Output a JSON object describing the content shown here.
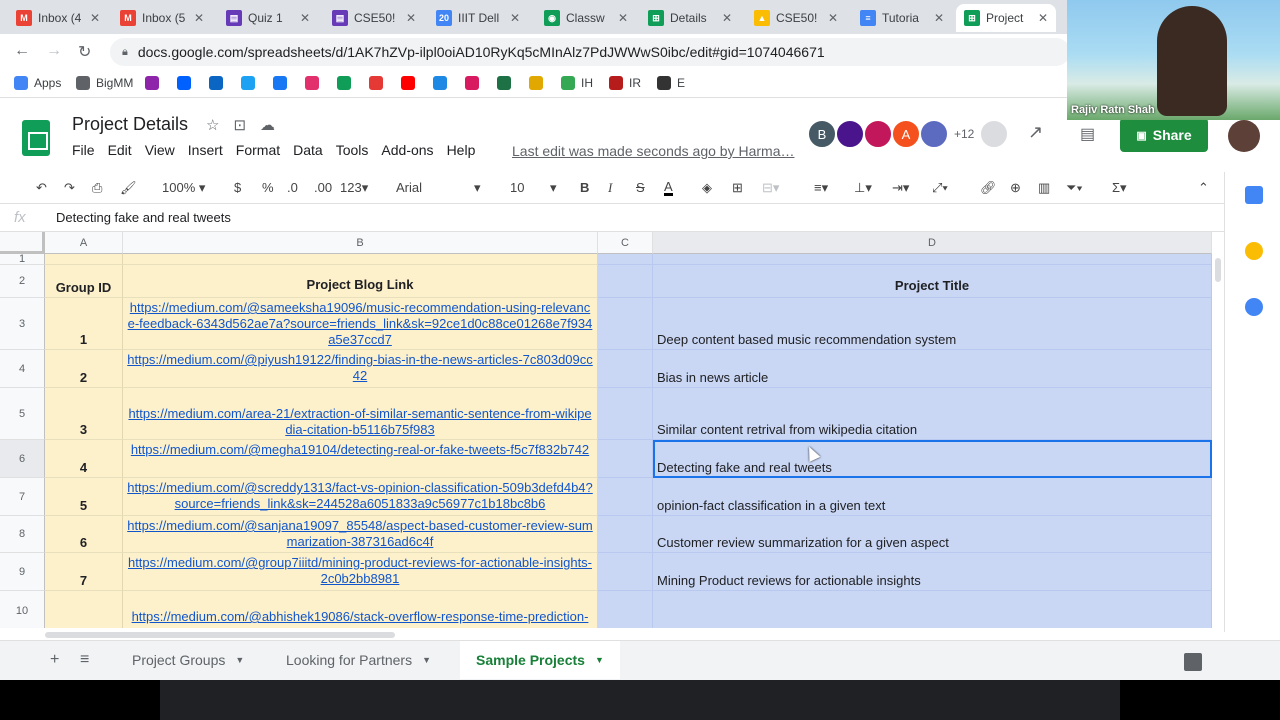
{
  "browser": {
    "tabs": [
      {
        "label": "Inbox (4",
        "fav": "M",
        "color": "#ea4335"
      },
      {
        "label": "Inbox (5",
        "fav": "M",
        "color": "#ea4335"
      },
      {
        "label": "Quiz 1",
        "fav": "▤",
        "color": "#673ab7"
      },
      {
        "label": "CSE50!",
        "fav": "▤",
        "color": "#673ab7"
      },
      {
        "label": "IIIT Dell",
        "fav": "20",
        "color": "#4285f4"
      },
      {
        "label": "Classw",
        "fav": "◉",
        "color": "#0f9d58"
      },
      {
        "label": "Details",
        "fav": "⊞",
        "color": "#0f9d58"
      },
      {
        "label": "CSE50!",
        "fav": "▲",
        "color": "#fbbc04"
      },
      {
        "label": "Tutoria",
        "fav": "≡",
        "color": "#4285f4"
      },
      {
        "label": "Project",
        "fav": "⊞",
        "color": "#0f9d58"
      }
    ],
    "url": "docs.google.com/spreadsheets/d/1AK7hZVp-ilpl0oiAD10RyKq5cMInAlz7PdJWWwS0ibc/edit#gid=1074046671",
    "bookmarks": [
      {
        "label": "Apps",
        "color": "#4285f4"
      },
      {
        "label": "BigMM",
        "color": "#5f6368"
      },
      {
        "label": "",
        "color": "#8e24aa"
      },
      {
        "label": "",
        "color": "#0061ff"
      },
      {
        "label": "",
        "color": "#0a66c2"
      },
      {
        "label": "",
        "color": "#1da1f2"
      },
      {
        "label": "",
        "color": "#1877f2"
      },
      {
        "label": "",
        "color": "#e1306c"
      },
      {
        "label": "",
        "color": "#0f9d58"
      },
      {
        "label": "",
        "color": "#e53935"
      },
      {
        "label": "",
        "color": "#ff0000"
      },
      {
        "label": "",
        "color": "#1e88e5"
      },
      {
        "label": "",
        "color": "#d81b60"
      },
      {
        "label": "",
        "color": "#1e7145"
      },
      {
        "label": "",
        "color": "#e0a800"
      },
      {
        "label": "IH",
        "color": "#34a853"
      },
      {
        "label": "IR",
        "color": "#b71c1c"
      },
      {
        "label": "E",
        "color": "#333333"
      }
    ]
  },
  "video": {
    "name": "Rajiv Ratn Shah"
  },
  "doc": {
    "title": "Project Details",
    "menu": [
      "File",
      "Edit",
      "View",
      "Insert",
      "Format",
      "Data",
      "Tools",
      "Add-ons",
      "Help"
    ],
    "last_edit": "Last edit was made seconds ago by Harma…",
    "collaborators": [
      {
        "initial": "B",
        "color": "#455a64"
      },
      {
        "initial": "",
        "color": "#4a148c"
      },
      {
        "initial": "",
        "color": "#c2185b"
      },
      {
        "initial": "A",
        "color": "#f4511e"
      },
      {
        "initial": "",
        "color": "#5c6bc0"
      }
    ],
    "more_collaborators": "+12",
    "share_label": "Share"
  },
  "toolbar": {
    "zoom": "100%",
    "currency": "$",
    "percent": "%",
    "dec_less": ".0",
    "dec_more": ".00",
    "format": "123",
    "font": "Arial",
    "size": "10"
  },
  "formula": {
    "fx": "fx",
    "value": "Detecting fake and real tweets"
  },
  "sheet": {
    "columns": [
      "A",
      "B",
      "C",
      "D"
    ],
    "headers": {
      "group": "Group ID",
      "blog": "Project Blog Link",
      "title": "Project Title"
    },
    "rows": [
      {
        "num": "3",
        "group": "1",
        "link": "https://medium.com/@sameeksha19096/music-recommendation-using-relevance-feedback-6343d562ae7a?source=friends_link&sk=92ce1d0c88ce01268e7f934a5e37ccd7",
        "title": "Deep content based music recommendation system"
      },
      {
        "num": "4",
        "group": "2",
        "link": "https://medium.com/@piyush19122/finding-bias-in-the-news-articles-7c803d09cc42",
        "title": "Bias in news article"
      },
      {
        "num": "5",
        "group": "3",
        "link": "https://medium.com/area-21/extraction-of-similar-semantic-sentence-from-wikipedia-citation-b5116b75f983",
        "title": "Similar content retrival from wikipedia citation"
      },
      {
        "num": "6",
        "group": "4",
        "link": "https://medium.com/@megha19104/detecting-real-or-fake-tweets-f5c7f832b742",
        "title": "Detecting fake and real tweets"
      },
      {
        "num": "7",
        "group": "5",
        "link": "https://medium.com/@screddy1313/fact-vs-opinion-classification-509b3defd4b4?source=friends_link&sk=244528a6051833a9c56977c1b18bc8b6",
        "title": "opinion-fact classification in a given text"
      },
      {
        "num": "8",
        "group": "6",
        "link": "https://medium.com/@sanjana19097_85548/aspect-based-customer-review-summarization-387316ad6c4f",
        "title": "Customer review summarization for a given aspect"
      },
      {
        "num": "9",
        "group": "7",
        "link": "https://medium.com/@group7iiitd/mining-product-reviews-for-actionable-insights-2c0b2bb8981",
        "title": "Mining Product reviews for actionable insights"
      },
      {
        "num": "10",
        "group": "",
        "link": "https://medium.com/@abhishek19086/stack-overflow-response-time-prediction-",
        "title": ""
      }
    ]
  },
  "sheet_tabs": [
    "Project Groups",
    "Looking for Partners",
    "Sample Projects"
  ]
}
